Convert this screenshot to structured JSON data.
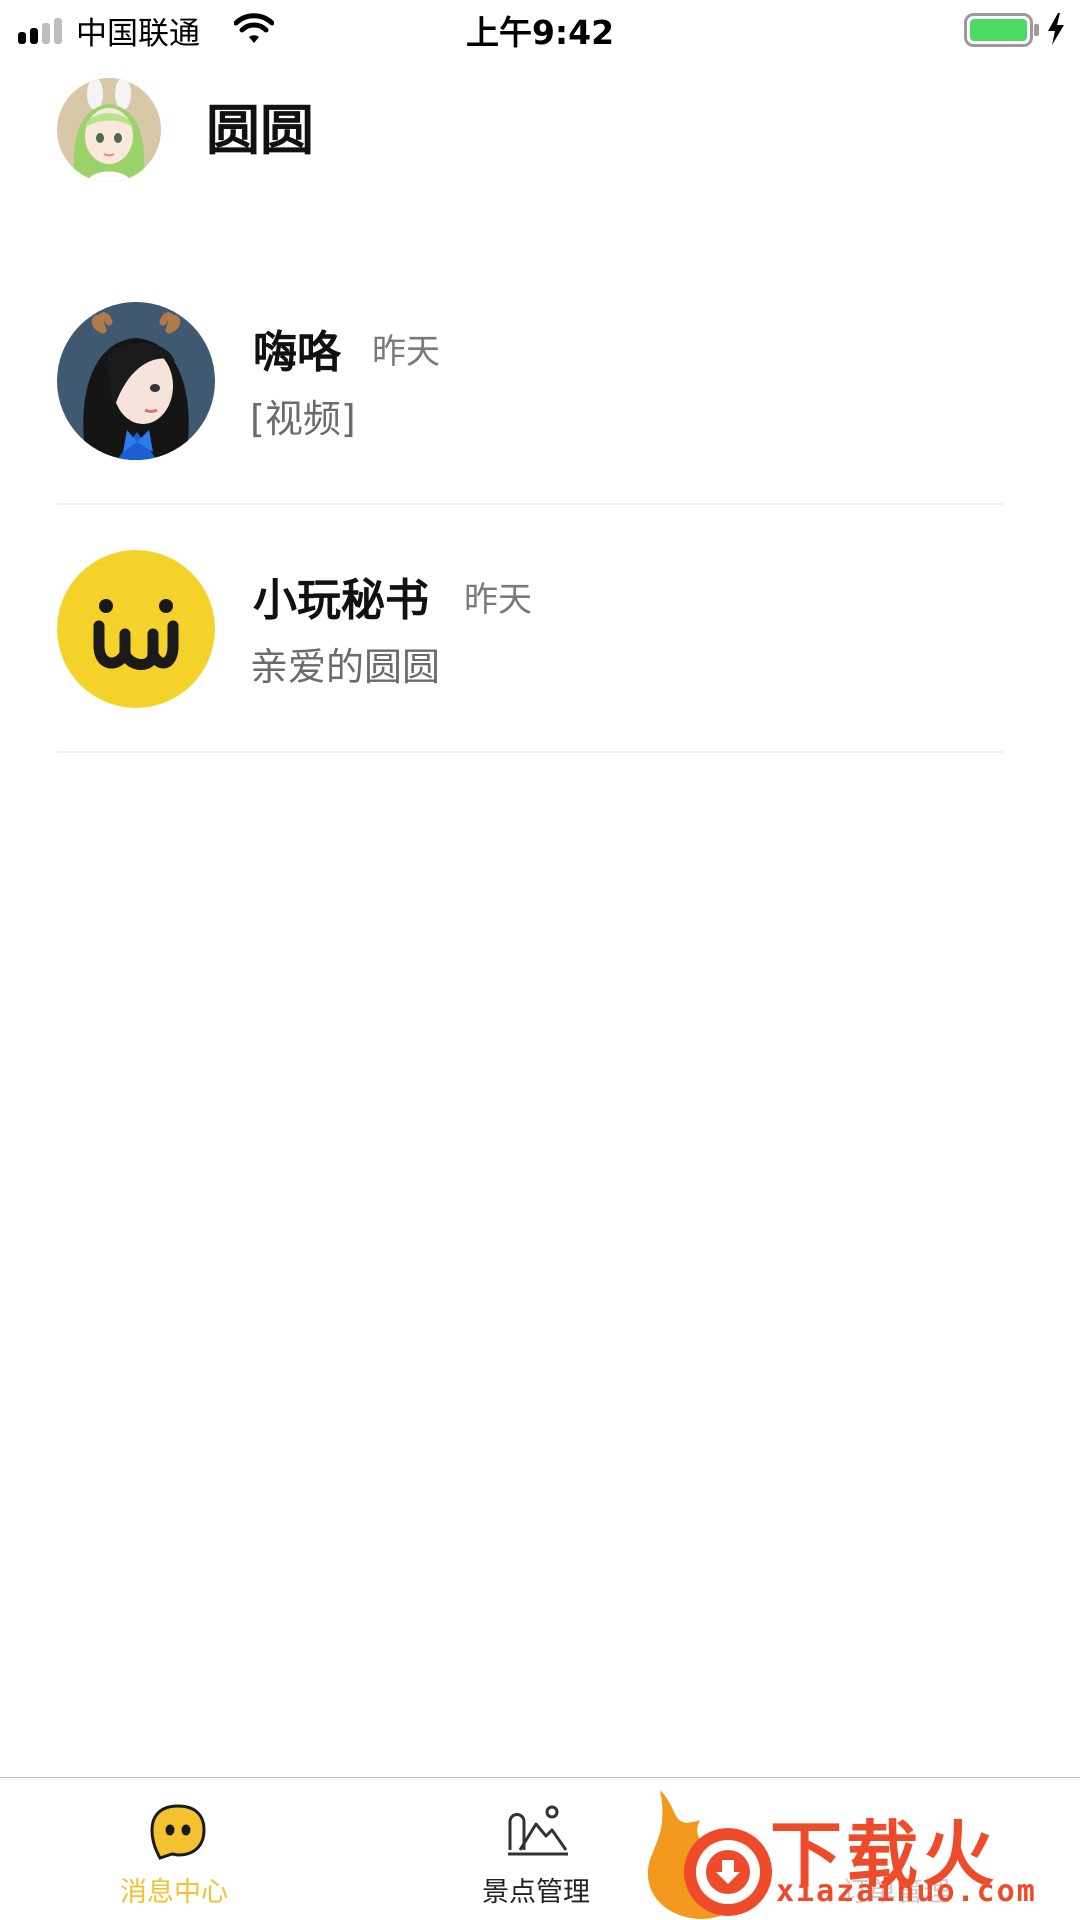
{
  "status_bar": {
    "carrier": "中国联通",
    "time": "上午9:42",
    "battery_color": "#4cd964"
  },
  "header": {
    "title": "圆圆",
    "avatar_icon": "user-avatar-anime-girl"
  },
  "conversations": [
    {
      "name": "嗨咯",
      "time": "昨天",
      "preview": "[视频]",
      "avatar_icon": "avatar-girl-deer-antlers"
    },
    {
      "name": "小玩秘书",
      "time": "昨天",
      "preview": "亲爱的圆圆",
      "avatar_icon": "xiaowan-logo",
      "avatar_color": "#f4d22a"
    }
  ],
  "tab_bar": {
    "tabs": [
      {
        "label": "消息中心",
        "icon": "chat-bubble-icon",
        "active": true,
        "color": "#f2c230"
      },
      {
        "label": "景点管理",
        "icon": "scenic-spot-icon",
        "active": false,
        "color": "#333333"
      },
      {
        "label": "订单管理",
        "icon": "order-icon",
        "active": false,
        "color": "#cccccc"
      }
    ]
  },
  "watermark": {
    "text": "下载火",
    "url": "xiazaihuo.com"
  }
}
